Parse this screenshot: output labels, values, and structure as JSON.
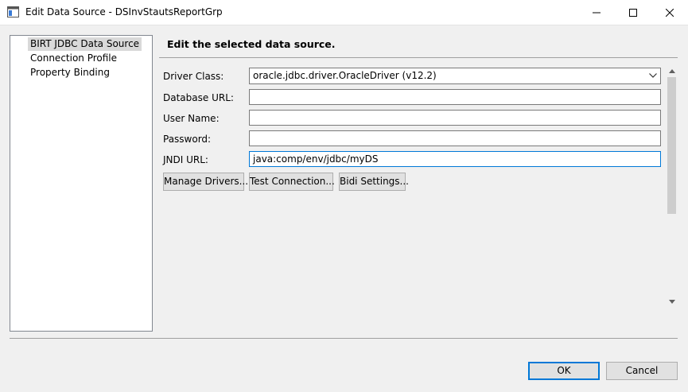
{
  "window": {
    "title": "Edit Data Source - DSInvStautsReportGrp"
  },
  "tree": {
    "items": [
      {
        "label": "BIRT JDBC Data Source",
        "selected": true
      },
      {
        "label": "Connection Profile",
        "selected": false
      },
      {
        "label": "Property Binding",
        "selected": false
      }
    ]
  },
  "panel": {
    "heading": "Edit the selected data source.",
    "driver_class_label": "Driver Class:",
    "driver_class_value": "oracle.jdbc.driver.OracleDriver (v12.2)",
    "database_url_label": "Database URL:",
    "database_url_value": "",
    "user_name_label": "User Name:",
    "user_name_value": "",
    "password_label": "Password:",
    "password_value": "",
    "jndi_url_label": "JNDI URL:",
    "jndi_url_value": "java:comp/env/jdbc/myDS",
    "manage_drivers": "Manage Drivers...",
    "test_connection": "Test Connection...",
    "bidi_settings": "Bidi Settings..."
  },
  "footer": {
    "ok": "OK",
    "cancel": "Cancel"
  },
  "colors": {
    "accent": "#0078d7",
    "selection": "#d9d9d9"
  }
}
